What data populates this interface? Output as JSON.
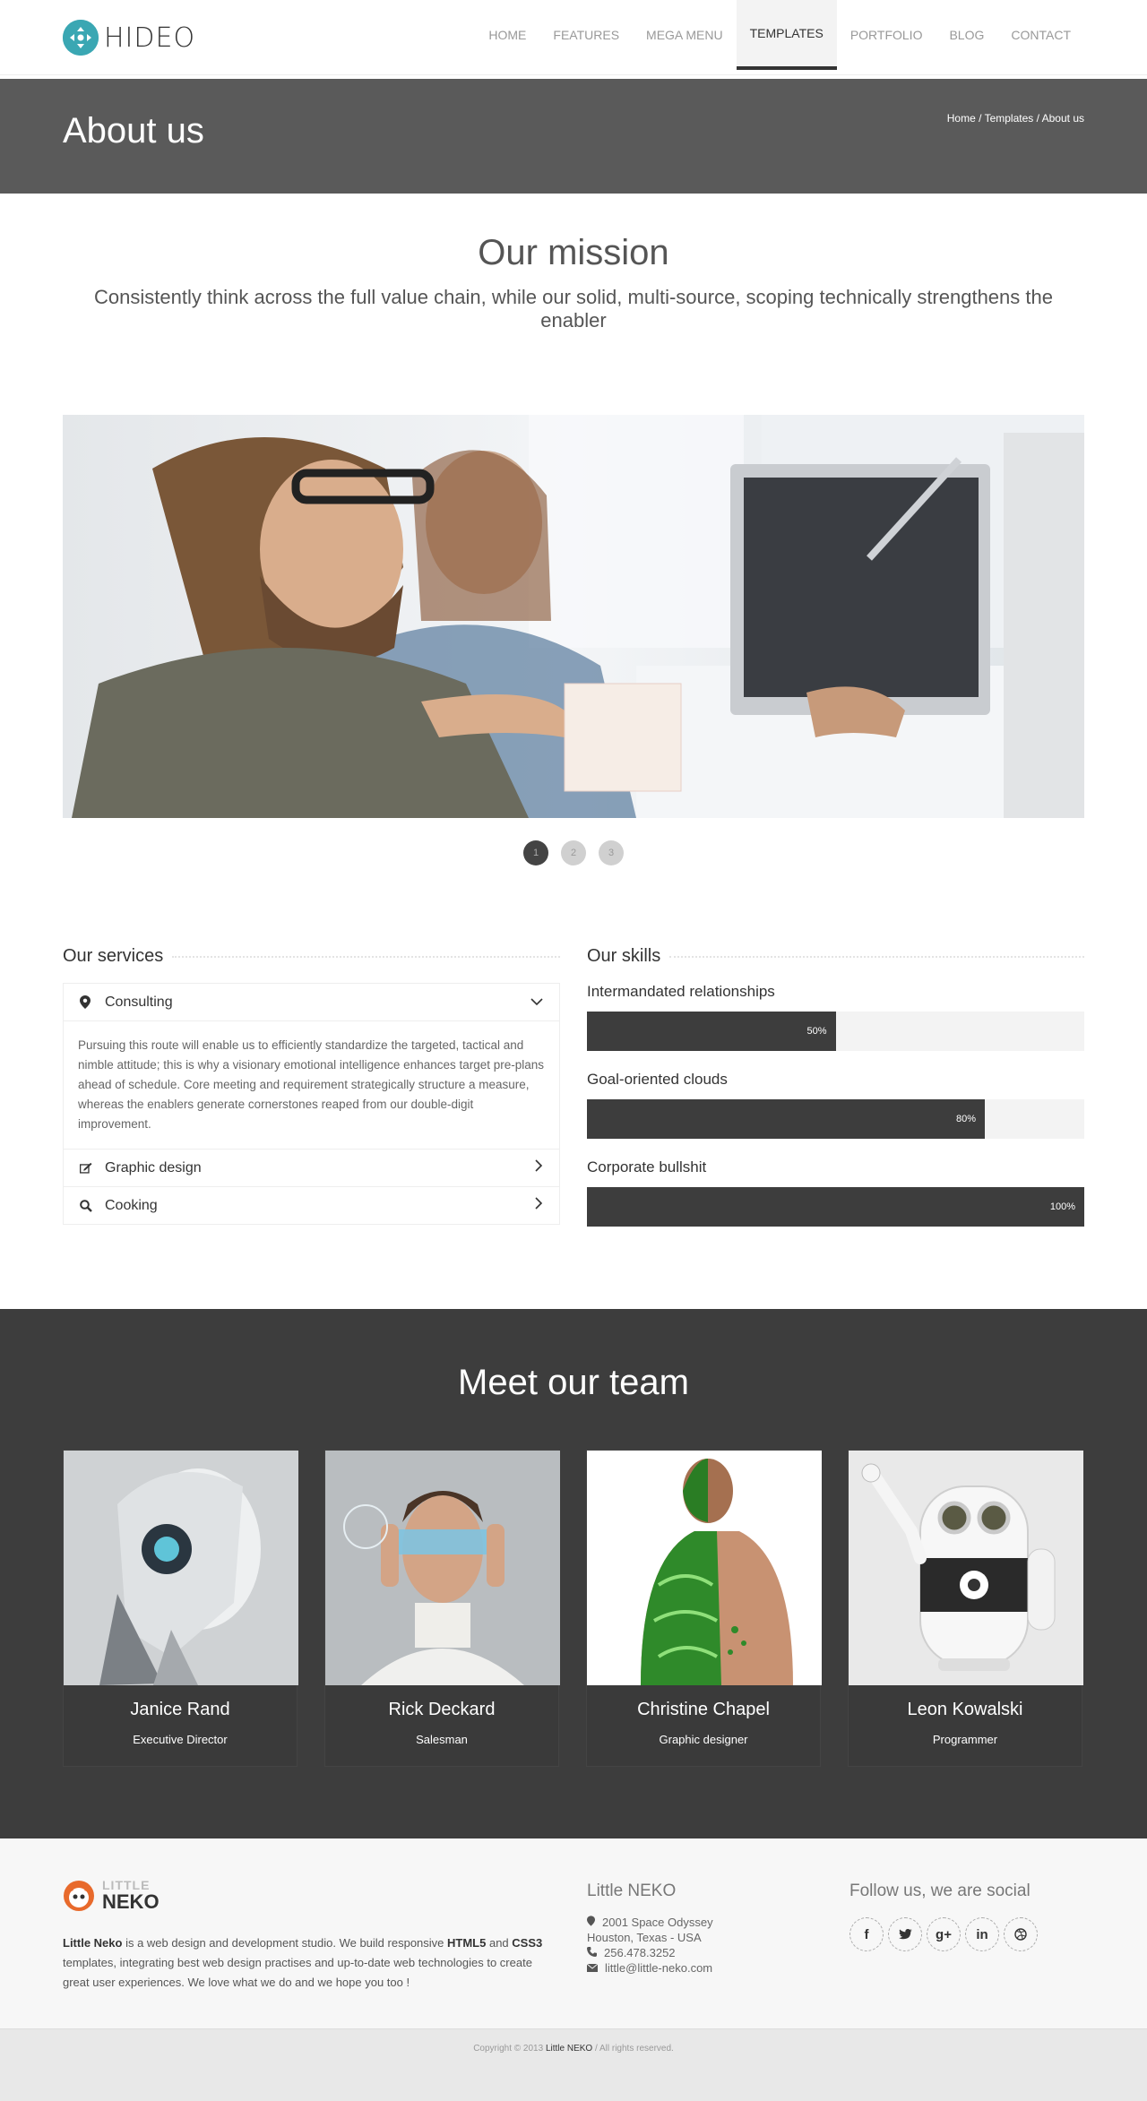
{
  "brand": {
    "name": "HIDEO",
    "accent": "#3aa7b3"
  },
  "nav": {
    "items": [
      {
        "label": "HOME"
      },
      {
        "label": "FEATURES"
      },
      {
        "label": "MEGA MENU"
      },
      {
        "label": "TEMPLATES",
        "active": true
      },
      {
        "label": "PORTFOLIO"
      },
      {
        "label": "BLOG"
      },
      {
        "label": "CONTACT"
      }
    ]
  },
  "titlebar": {
    "title": "About us",
    "breadcrumb": {
      "home": "Home",
      "sep1": " / ",
      "templates": "Templates",
      "sep2": " / ",
      "current": "About us"
    }
  },
  "mission": {
    "title": "Our mission",
    "text": "Consistently think across the full value chain, while our solid, multi-source, scoping technically strengthens the enabler"
  },
  "slider": {
    "dots": [
      "1",
      "2",
      "3"
    ],
    "active_index": 0
  },
  "services": {
    "title": "Our services",
    "items": [
      {
        "label": "Consulting",
        "icon": "map-marker-icon",
        "expanded": true,
        "body": "Pursuing this route will enable us to efficiently standardize the targeted, tactical and nimble attitude; this is why a visionary emotional intelligence enhances target pre-plans ahead of schedule. Core meeting and requirement strategically structure a measure, whereas the enablers generate cornerstones reaped from our double-digit improvement."
      },
      {
        "label": "Graphic design",
        "icon": "edit-icon",
        "expanded": false
      },
      {
        "label": "Cooking",
        "icon": "search-icon",
        "expanded": false
      }
    ]
  },
  "skills": {
    "title": "Our skills",
    "items": [
      {
        "label": "Intermandated relationships",
        "percent": 50,
        "text": "50%"
      },
      {
        "label": "Goal-oriented clouds",
        "percent": 80,
        "text": "80%"
      },
      {
        "label": "Corporate bullshit",
        "percent": 100,
        "text": "100%"
      }
    ]
  },
  "team": {
    "title": "Meet our team",
    "members": [
      {
        "name": "Janice Rand",
        "role": "Executive Director"
      },
      {
        "name": "Rick Deckard",
        "role": "Salesman"
      },
      {
        "name": "Christine Chapel",
        "role": "Graphic designer"
      },
      {
        "name": "Leon Kowalski",
        "role": "Programmer"
      }
    ]
  },
  "footer": {
    "logo_top": "LITTLE",
    "logo_bottom": "NEKO",
    "about_brand": "Little Neko",
    "about_text": " is a web design and development studio. We build responsive ",
    "about_html5": "HTML5",
    "about_and": " and ",
    "about_css3": "CSS3",
    "about_rest": " templates, integrating best web design practises and up-to-date web technologies to create great user experiences. We love what we do and we hope you too !",
    "contact_title": "Little NEKO",
    "address1": "2001 Space Odyssey",
    "address2": "Houston, Texas - USA",
    "phone": "256.478.3252",
    "email": "little@little-neko.com",
    "social_title": "Follow us, we are social",
    "socials": [
      "f",
      "t",
      "g+",
      "in",
      "dr"
    ]
  },
  "copyright": {
    "prefix": "Copyright © 2013 ",
    "brand": "Little NEKO",
    "suffix": " / All rights reserved."
  }
}
